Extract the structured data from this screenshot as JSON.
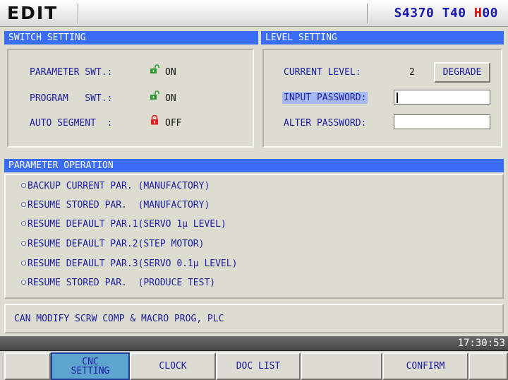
{
  "header": {
    "mode": "EDIT",
    "status_prefix": "S4370 T40 ",
    "status_h_letter": "H",
    "status_h_digits": "00"
  },
  "switch_setting": {
    "title": "SWITCH SETTING",
    "rows": [
      {
        "label": "PARAMETER SWT.:",
        "value": "ON",
        "icon": "unlocked-padlock-icon"
      },
      {
        "label": "PROGRAM   SWT.:",
        "value": "ON",
        "icon": "unlocked-padlock-icon"
      },
      {
        "label": "AUTO SEGMENT  :",
        "value": "OFF",
        "icon": "locked-padlock-icon"
      }
    ]
  },
  "level_setting": {
    "title": "LEVEL SETTING",
    "current_level_label": "CURRENT LEVEL:",
    "current_level_value": "2",
    "degrade_label": "DEGRADE",
    "input_password_label": "INPUT PASSWORD:",
    "input_password_value": "",
    "alter_password_label": "ALTER PASSWORD:",
    "alter_password_value": ""
  },
  "parameter_operation": {
    "title": "PARAMETER OPERATION",
    "options": [
      "BACKUP CURRENT PAR. (MANUFACTORY)",
      "RESUME STORED PAR.  (MANUFACTORY)",
      "RESUME DEFAULT PAR.1(SERVO 1µ LEVEL)",
      "RESUME DEFAULT PAR.2(STEP MOTOR)",
      "RESUME DEFAULT PAR.3(SERVO 0.1µ LEVEL)",
      "RESUME STORED PAR.  (PRODUCE TEST)"
    ]
  },
  "message": "CAN MODIFY SCRW COMP & MACRO PROG, PLC",
  "clock": "17:30:53",
  "softkeys": [
    {
      "label": ""
    },
    {
      "label": "CNC\nSETTING",
      "active": true
    },
    {
      "label": "CLOCK"
    },
    {
      "label": "DOC LIST"
    },
    {
      "label": ""
    },
    {
      "label": "CONFIRM"
    },
    {
      "label": ""
    }
  ],
  "colors": {
    "title_bar": "#3b6cf4",
    "label_text": "#1c1ca0",
    "status_highlight": "#e80000",
    "lock_green": "#2e9a2e",
    "lock_red": "#e02020",
    "active_softkey": "#5da4ce"
  }
}
